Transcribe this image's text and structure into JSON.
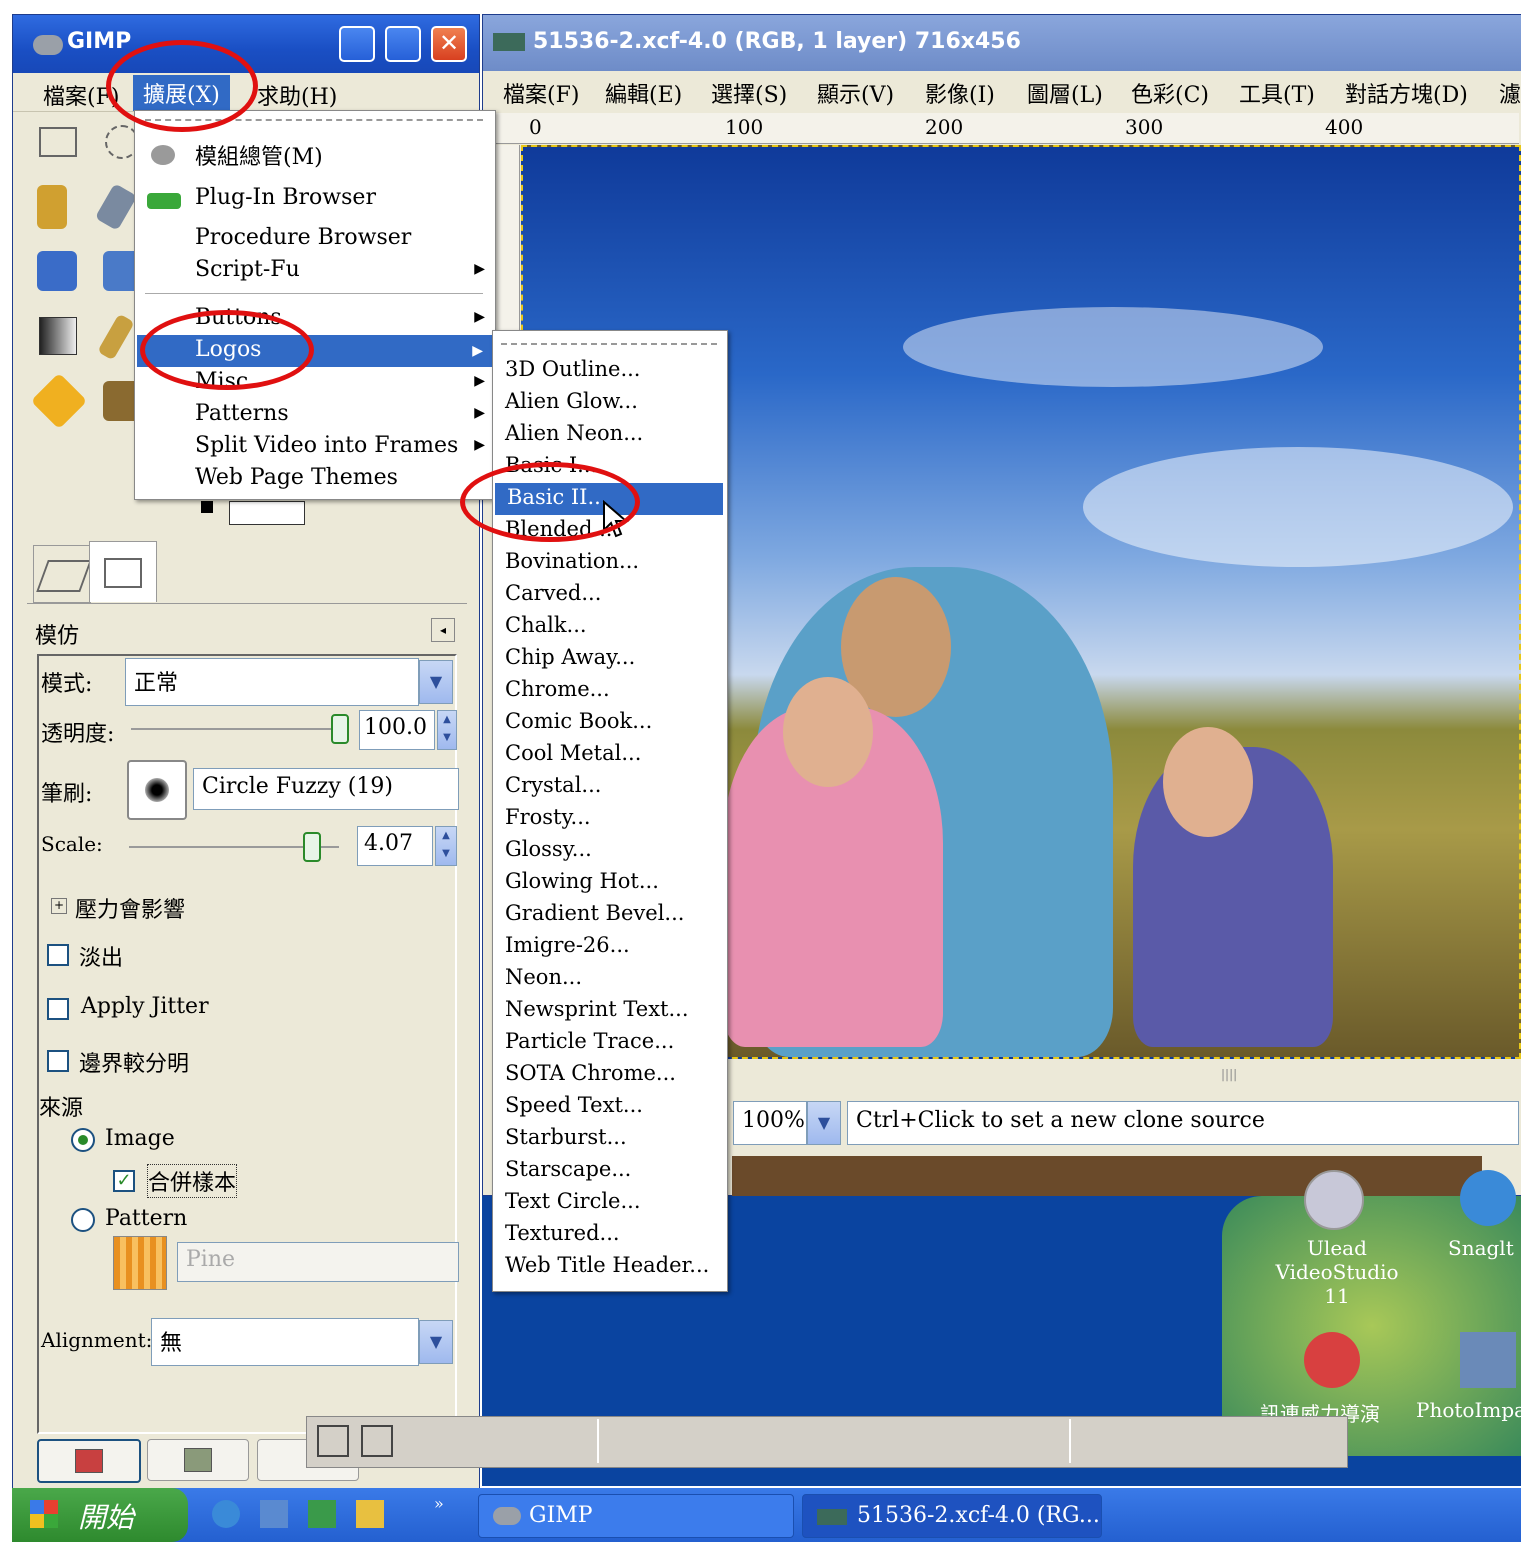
{
  "toolbox": {
    "title": "GIMP",
    "menu": {
      "file": "檔案(F)",
      "xtns": "擴展(X)",
      "help": "求助(H)"
    }
  },
  "extensions_menu": {
    "items": [
      {
        "label": "模組總管(M)",
        "icon": "module-icon"
      },
      {
        "label": "Plug-In Browser",
        "icon": "plugin-icon"
      },
      {
        "label": "Procedure Browser"
      },
      {
        "label": "Script-Fu",
        "submenu": true
      },
      {
        "label": "Buttons",
        "submenu": true
      },
      {
        "label": "Logos",
        "submenu": true,
        "highlighted": true
      },
      {
        "label": "Misc",
        "submenu": true
      },
      {
        "label": "Patterns",
        "submenu": true
      },
      {
        "label": "Split Video into Frames",
        "submenu": true
      },
      {
        "label": "Web Page Themes",
        "submenu": true
      }
    ]
  },
  "logos_menu": {
    "items": [
      "3D Outline...",
      "Alien Glow...",
      "Alien Neon...",
      "Basic I...",
      "Basic II...",
      "Blended...",
      "Bovination...",
      "Carved...",
      "Chalk...",
      "Chip Away...",
      "Chrome...",
      "Comic Book...",
      "Cool Metal...",
      "Crystal...",
      "Frosty...",
      "Glossy...",
      "Glowing Hot...",
      "Gradient Bevel...",
      "Imigre-26...",
      "Neon...",
      "Newsprint Text...",
      "Particle Trace...",
      "SOTA Chrome...",
      "Speed Text...",
      "Starburst...",
      "Starscape...",
      "Text Circle...",
      "Textured...",
      "Web Title Header..."
    ],
    "highlighted": "Basic II..."
  },
  "tool_options": {
    "title": "模仿",
    "mode_label": "模式:",
    "mode_value": "正常",
    "opacity_label": "透明度:",
    "opacity_value": "100.0",
    "opacity_fraction": 1.0,
    "brush_label": "筆刷:",
    "brush_value": "Circle Fuzzy (19)",
    "scale_label": "Scale:",
    "scale_value": "4.07",
    "pressure_label": "壓力會影響",
    "fade_label": "淡出",
    "jitter_label": "Apply Jitter",
    "hard_edge_label": "邊界較分明",
    "source_label": "來源",
    "source_image": "Image",
    "sample_merged": "合併樣本",
    "source_pattern": "Pattern",
    "pattern_name": "Pine",
    "alignment_label": "Alignment:",
    "alignment_value": "無"
  },
  "image_window": {
    "title": "51536-2.xcf-4.0 (RGB, 1 layer) 716x456",
    "menu": [
      "檔案(F)",
      "編輯(E)",
      "選擇(S)",
      "顯示(V)",
      "影像(I)",
      "圖層(L)",
      "色彩(C)",
      "工具(T)",
      "對話方塊(D)",
      "濾"
    ],
    "ruler_marks": [
      "0",
      "100",
      "200",
      "300",
      "400"
    ],
    "zoom": "100%",
    "status": "Ctrl+Click to set a new clone source"
  },
  "desktop": {
    "icons": [
      {
        "label": "Ulead VideoStudio 11"
      },
      {
        "label": "Snaglt"
      },
      {
        "label": "訊連威力導演"
      },
      {
        "label": "PhotoImpa"
      }
    ]
  },
  "taskbar": {
    "start": "開始",
    "items": [
      "GIMP",
      "51536-2.xcf-4.0 (RG..."
    ]
  },
  "colors": {
    "selection": "#316ac5",
    "annotation": "#e01010",
    "titlebar": "#1a4fc4"
  }
}
